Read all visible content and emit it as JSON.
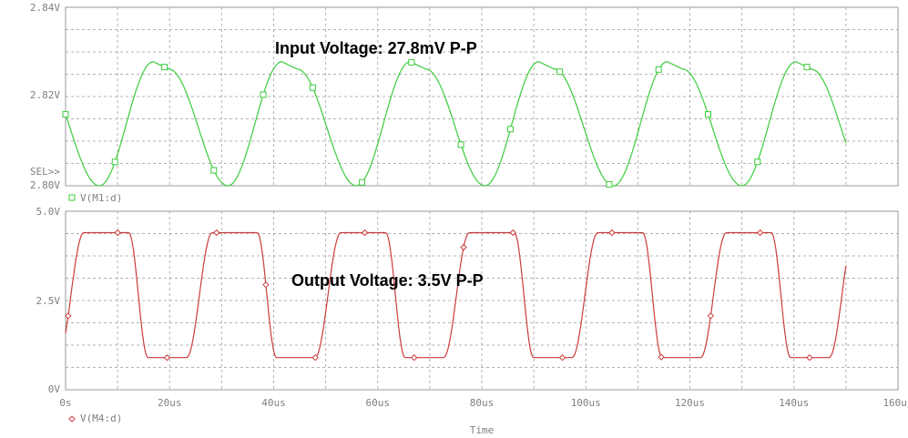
{
  "chart_data": [
    {
      "type": "line",
      "panel": "top",
      "series": [
        {
          "name": "V(M1:d)",
          "color": "#3ccc3c",
          "marker": "square",
          "period_us": 24.7,
          "min": 2.8,
          "max": 2.8278,
          "x": [
            0,
            2,
            4,
            6,
            8,
            10,
            12,
            14,
            16,
            17,
            18,
            20,
            22,
            24,
            26,
            28,
            30,
            32
          ],
          "y": [
            2.815,
            2.808,
            2.802,
            2.8,
            2.801,
            2.804,
            2.81,
            2.818,
            2.826,
            2.8278,
            2.826,
            2.826,
            2.822,
            2.816,
            2.809,
            2.803,
            2.8,
            2.801
          ]
        }
      ],
      "xlim": [
        0,
        160
      ],
      "ylim": [
        2.8,
        2.84
      ],
      "yticks": [
        "2.84V",
        "2.82V",
        "2.80V"
      ],
      "sel_label": "SEL>>",
      "annotation": "Input Voltage: 27.8mV P-P",
      "grid": true
    },
    {
      "type": "line",
      "panel": "bottom",
      "series": [
        {
          "name": "V(M4:d)",
          "color": "#cc3c3c",
          "marker": "diamond",
          "period_us": 24.7,
          "min": 0.9,
          "max": 4.4
        }
      ],
      "xlim": [
        0,
        160
      ],
      "ylim": [
        0,
        5
      ],
      "yticks": [
        "5.0V",
        "2.5V",
        "0V"
      ],
      "xticks": [
        "0s",
        "20us",
        "40us",
        "60us",
        "80us",
        "100us",
        "120us",
        "140us",
        "160us"
      ],
      "xlabel": "Time",
      "annotation": "Output Voltage: 3.5V P-P",
      "grid": true
    }
  ]
}
